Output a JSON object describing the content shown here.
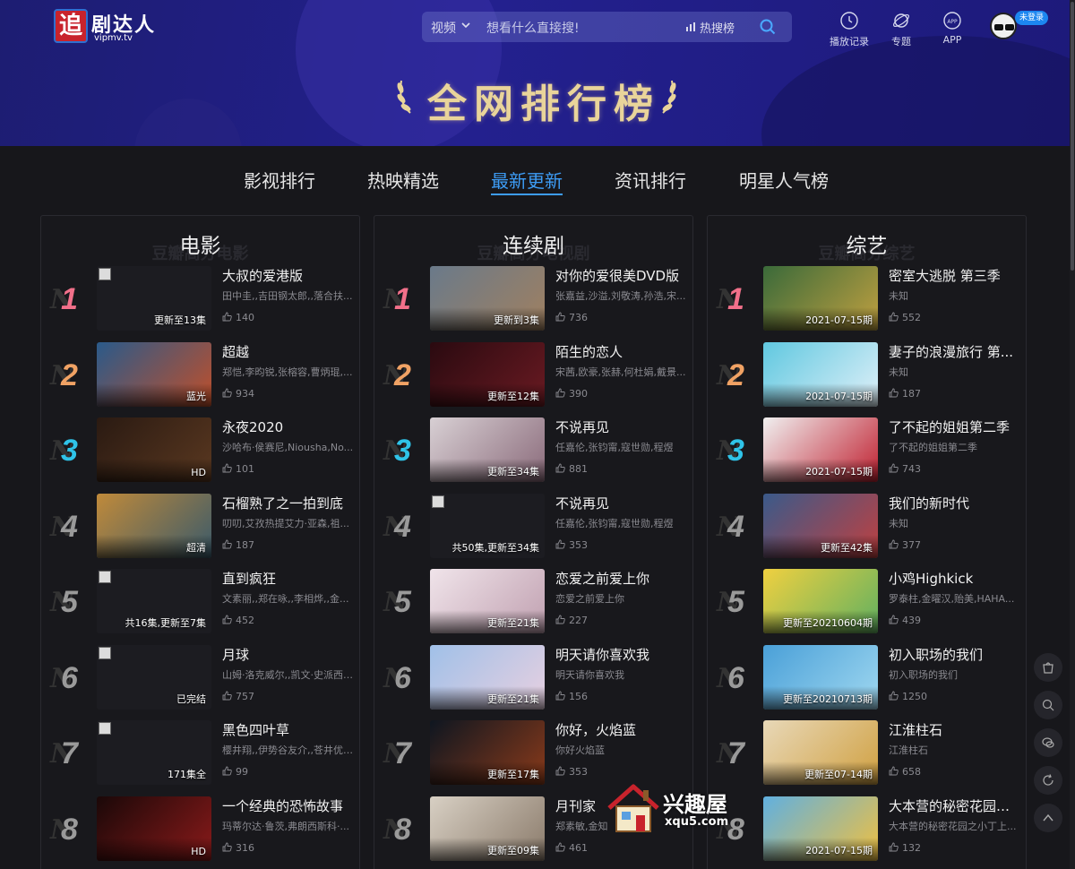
{
  "header": {
    "logo_text": "剧达人",
    "logo_mark": "追",
    "logo_domain": "vipmv.tv",
    "search": {
      "category": "视频",
      "placeholder": "想看什么直接搜!",
      "hot_label": "热搜榜"
    },
    "nav": [
      {
        "label": "播放记录",
        "icon": "history-clock-icon"
      },
      {
        "label": "专题",
        "icon": "topic-planet-icon"
      },
      {
        "label": "APP",
        "icon": "app-icon"
      }
    ],
    "login_badge": "未登录"
  },
  "banner": {
    "title": "全网排行榜"
  },
  "tabs": [
    {
      "label": "影视排行",
      "active": false
    },
    {
      "label": "热映精选",
      "active": false
    },
    {
      "label": "最新更新",
      "active": true
    },
    {
      "label": "资讯排行",
      "active": false
    },
    {
      "label": "明星人气榜",
      "active": false
    }
  ],
  "columns": [
    {
      "title": "电影",
      "watermark": "豆瓣高分电影",
      "items": [
        {
          "rank": "1",
          "title": "大叔的爱港版",
          "cast": "田中圭,,吉田钢太郎,,落合扶...",
          "likes": "140",
          "tag": "更新至13集",
          "thumb": "placeholder",
          "colors": [
            "#1c1c21",
            "#1c1c21"
          ]
        },
        {
          "rank": "2",
          "title": "超越",
          "cast": "郑恺,李昀锐,张榕容,曹炳琨,...",
          "likes": "934",
          "tag": "蓝光",
          "thumb": "image",
          "colors": [
            "#2a5a8a",
            "#c04f2a"
          ]
        },
        {
          "rank": "3",
          "title": "永夜2020",
          "cast": "沙哈布·侯赛尼,Niousha,No...",
          "likes": "101",
          "tag": "HD",
          "thumb": "image",
          "colors": [
            "#2a1a12",
            "#5a3820"
          ]
        },
        {
          "rank": "4",
          "title": "石榴熟了之一拍到底",
          "cast": "叨叨,艾孜热提艾力·亚森,祖...",
          "likes": "187",
          "tag": "超清",
          "thumb": "image",
          "colors": [
            "#c08a3a",
            "#3a5a6a"
          ]
        },
        {
          "rank": "5",
          "title": "直到疯狂",
          "cast": "文素丽,,郑在咏,,李相烨,,金...",
          "likes": "452",
          "tag": "共16集,更新至7集",
          "thumb": "placeholder",
          "colors": [
            "#1c1c21",
            "#1c1c21"
          ]
        },
        {
          "rank": "6",
          "title": "月球",
          "cast": "山姆·洛克威尔,,凯文·史派西,...",
          "likes": "757",
          "tag": "已完结",
          "thumb": "placeholder",
          "colors": [
            "#1c1c21",
            "#1c1c21"
          ]
        },
        {
          "rank": "7",
          "title": "黑色四叶草",
          "cast": "樱井翔,,伊势谷友介,,苍井优,...",
          "likes": "99",
          "tag": "171集全",
          "thumb": "placeholder",
          "colors": [
            "#1c1c21",
            "#1c1c21"
          ]
        },
        {
          "rank": "8",
          "title": "一个经典的恐怖故事",
          "cast": "玛蒂尔达·鲁茨,弗朗西斯科·...",
          "likes": "316",
          "tag": "HD",
          "thumb": "image",
          "colors": [
            "#1a0808",
            "#8a1a1a"
          ]
        }
      ]
    },
    {
      "title": "连续剧",
      "watermark": "豆瓣高分电视剧",
      "items": [
        {
          "rank": "1",
          "title": "对你的爱很美DVD版",
          "cast": "张嘉益,沙溢,刘敬涛,孙浩,宋...",
          "likes": "736",
          "tag": "更新到3集",
          "thumb": "image",
          "colors": [
            "#6a7a8a",
            "#a08060"
          ]
        },
        {
          "rank": "2",
          "title": "陌生的恋人",
          "cast": "宋茜,欧豪,张赫,何杜娟,戴景...",
          "likes": "390",
          "tag": "更新至12集",
          "thumb": "image",
          "colors": [
            "#2a0a10",
            "#6a1a22"
          ]
        },
        {
          "rank": "3",
          "title": "不说再见",
          "cast": "任嘉伦,张钧甯,寇世勋,程煜",
          "likes": "881",
          "tag": "更新至34集",
          "thumb": "image",
          "colors": [
            "#d8d0d4",
            "#8a6a7a"
          ]
        },
        {
          "rank": "4",
          "title": "不说再见",
          "cast": "任嘉伦,张钧甯,寇世勋,程煜",
          "likes": "353",
          "tag": "共50集,更新至34集",
          "thumb": "placeholder",
          "colors": [
            "#1c1c21",
            "#1c1c21"
          ]
        },
        {
          "rank": "5",
          "title": "恋爱之前爱上你",
          "cast": "恋爱之前爱上你",
          "likes": "227",
          "tag": "更新至21集",
          "thumb": "image",
          "colors": [
            "#f0e4ea",
            "#c0a0b0"
          ]
        },
        {
          "rank": "6",
          "title": "明天请你喜欢我",
          "cast": "明天请你喜欢我",
          "likes": "156",
          "tag": "更新至21集",
          "thumb": "image",
          "colors": [
            "#a0c0e8",
            "#e8d0e0"
          ]
        },
        {
          "rank": "7",
          "title": "你好，火焰蓝",
          "cast": "你好火焰蓝",
          "likes": "353",
          "tag": "更新至17集",
          "thumb": "image",
          "colors": [
            "#0e1620",
            "#8a3a1a"
          ]
        },
        {
          "rank": "8",
          "title": "月刊家",
          "cast": "郑素敏,金知",
          "likes": "461",
          "tag": "更新至09集",
          "thumb": "image",
          "colors": [
            "#d8d0c4",
            "#8a7a6a"
          ]
        }
      ]
    },
    {
      "title": "综艺",
      "watermark": "豆瓣高分综艺",
      "items": [
        {
          "rank": "1",
          "title": "密室大逃脱 第三季",
          "cast": "未知",
          "likes": "552",
          "tag": "2021-07-15期",
          "thumb": "image",
          "colors": [
            "#3a6a3a",
            "#c0a040"
          ]
        },
        {
          "rank": "2",
          "title": "妻子的浪漫旅行 第...",
          "cast": "未知",
          "likes": "187",
          "tag": "2021-07-15期",
          "thumb": "image",
          "colors": [
            "#60c8e0",
            "#e0f0f8"
          ]
        },
        {
          "rank": "3",
          "title": "了不起的姐姐第二季",
          "cast": "了不起的姐姐第二季",
          "likes": "743",
          "tag": "2021-07-15期",
          "thumb": "image",
          "colors": [
            "#f0f0f0",
            "#c02030"
          ]
        },
        {
          "rank": "4",
          "title": "我们的新时代",
          "cast": "未知",
          "likes": "377",
          "tag": "更新至42集",
          "thumb": "image",
          "colors": [
            "#3a5a8a",
            "#c04040"
          ]
        },
        {
          "rank": "5",
          "title": "小鸡Highkick",
          "cast": "罗泰柱,金曜汉,贻美,HAHA...",
          "likes": "439",
          "tag": "更新至20210604期",
          "thumb": "image",
          "colors": [
            "#f0d040",
            "#60b060"
          ]
        },
        {
          "rank": "6",
          "title": "初入职场的我们",
          "cast": "初入职场的我们",
          "likes": "1250",
          "tag": "更新至20210713期",
          "thumb": "image",
          "colors": [
            "#4aa0d8",
            "#a0d8f0"
          ]
        },
        {
          "rank": "7",
          "title": "江淮柱石",
          "cast": "江淮柱石",
          "likes": "658",
          "tag": "更新至07-14期",
          "thumb": "image",
          "colors": [
            "#e8d8b8",
            "#d0a040"
          ]
        },
        {
          "rank": "8",
          "title": "大本营的秘密花园之...",
          "cast": "大本营的秘密花园之小丁上...",
          "likes": "132",
          "tag": "2021-07-15期",
          "thumb": "image",
          "colors": [
            "#60b0e0",
            "#f0c040"
          ]
        }
      ]
    }
  ],
  "side_tools": [
    "shop-icon",
    "search-icon",
    "wechat-icon",
    "refresh-icon",
    "back-to-top-icon"
  ],
  "watermark": {
    "name": "兴趣屋",
    "domain": "xqu5.com"
  }
}
